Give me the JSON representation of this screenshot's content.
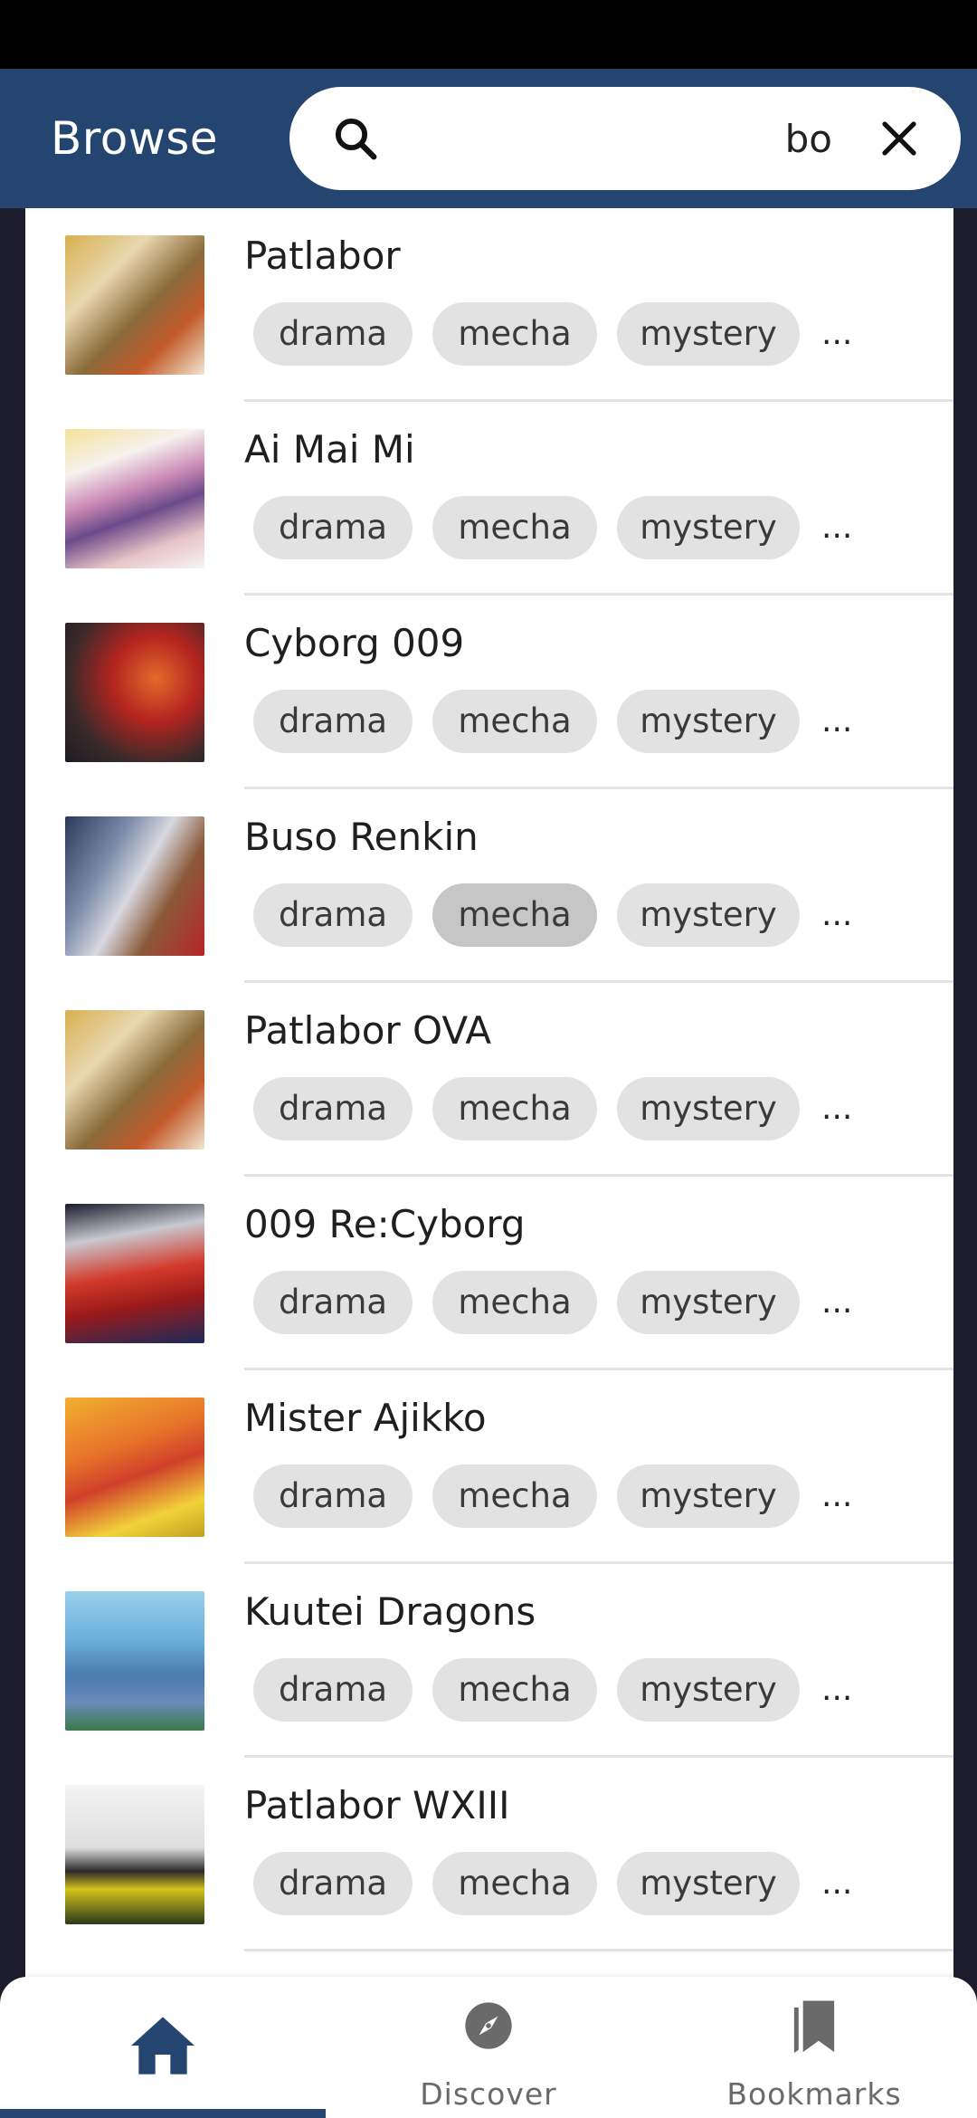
{
  "header": {
    "title": "Browse",
    "search_value": "bo"
  },
  "rows": [
    {
      "title": "Patlabor",
      "tags": [
        "drama",
        "mecha",
        "mystery"
      ],
      "more": "..."
    },
    {
      "title": "Ai Mai Mi",
      "tags": [
        "drama",
        "mecha",
        "mystery"
      ],
      "more": "..."
    },
    {
      "title": "Cyborg 009",
      "tags": [
        "drama",
        "mecha",
        "mystery"
      ],
      "more": "..."
    },
    {
      "title": "Buso Renkin",
      "tags": [
        "drama",
        "mecha",
        "mystery"
      ],
      "more": "..."
    },
    {
      "title": "Patlabor OVA",
      "tags": [
        "drama",
        "mecha",
        "mystery"
      ],
      "more": "..."
    },
    {
      "title": "009 Re:Cyborg",
      "tags": [
        "drama",
        "mecha",
        "mystery"
      ],
      "more": "..."
    },
    {
      "title": "Mister Ajikko",
      "tags": [
        "drama",
        "mecha",
        "mystery"
      ],
      "more": "..."
    },
    {
      "title": "Kuutei Dragons",
      "tags": [
        "drama",
        "mecha",
        "mystery"
      ],
      "more": "..."
    },
    {
      "title": "Patlabor WXIII",
      "tags": [
        "drama",
        "mecha",
        "mystery"
      ],
      "more": "..."
    }
  ],
  "nav": {
    "items": [
      {
        "label": "",
        "icon": "home-icon"
      },
      {
        "label": "Discover",
        "icon": "compass-icon"
      },
      {
        "label": "Bookmarks",
        "icon": "bookmarks-icon"
      }
    ]
  },
  "colors": {
    "appbar": "#23456f",
    "chip": "#e2e2e2",
    "chip_pressed": "#c6c6c6",
    "background": "#1d1d2d"
  }
}
